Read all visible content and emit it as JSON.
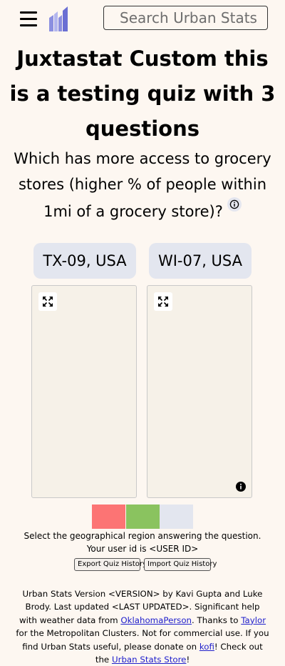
{
  "header": {
    "search_placeholder": "Search Urban Stats",
    "logo_colors": [
      "#8b8fe0",
      "#b3b6ee",
      "#6a6fd3"
    ]
  },
  "quiz": {
    "title": "Juxtastat Custom this is a testing quiz with 3 questions",
    "question": "Which has more access to grocery stores (higher % of people within 1mi of a grocery store)?",
    "choices": [
      {
        "label": "TX-09, USA"
      },
      {
        "label": "WI-07, USA"
      }
    ],
    "progress_colors": [
      "#fc7474",
      "#8ac35f",
      "#e3e6ef"
    ],
    "instruction": "Select the geographical region answering the question.",
    "user_id_text": "Your user id is <USER ID>",
    "export_label": "Export Quiz History",
    "import_label": "Import Quiz History"
  },
  "footer": {
    "text1": "Urban Stats Version <VERSION> by Kavi Gupta and Luke Brody. Last updated <LAST UPDATED>. Significant help with weather data from ",
    "link1": "OklahomaPerson",
    "text2": ". Thanks to ",
    "link2": "Taylor",
    "text3": " for the Metropolitan Clusters. Not for commercial use. If you find Urban Stats useful, please donate on ",
    "link3": "kofi",
    "text4": "! Check out the ",
    "link4": "Urban Stats Store",
    "text5": "!"
  },
  "colors": {
    "background": "#fdf7f1",
    "choice_bg": "#e3e6ef",
    "map_bg": "#f6f1e8",
    "link": "#2020cc"
  }
}
